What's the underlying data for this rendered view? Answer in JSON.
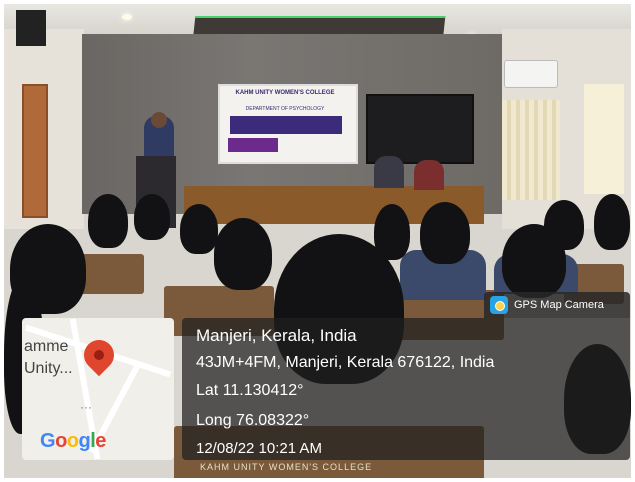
{
  "photo": {
    "gps_badge": {
      "label": "GPS Map Camera",
      "icon": "gps-map-camera-icon"
    },
    "location": {
      "title": "Manjeri, Kerala, India",
      "address": "43JM+4FM, Manjeri, Kerala 676122, India",
      "lat": "Lat 11.130412°",
      "long": "Long 76.08322°",
      "datetime": "12/08/22 10:21 AM"
    },
    "map": {
      "label_top": "amme",
      "label_mid": "Unity...",
      "logo_parts": [
        "G",
        "o",
        "o",
        "g",
        "l",
        "e"
      ],
      "pin_icon": "map-pin-icon"
    },
    "banner": {
      "college": "KAHM UNITY WOMEN'S COLLEGE",
      "department": "DEPARTMENT OF PSYCHOLOGY",
      "title": "WORKSHOP ON LEARNING AND BEHAVIOUR MANAGEMENT IN CHILDREN",
      "talk": "Talk by"
    },
    "chair_print": "KAHM UNITY WOMEN'S COLLEGE",
    "colors": {
      "accent_green": "#48d36a",
      "map_pin": "#e0452e",
      "overlay": "#1e1e1e"
    }
  }
}
